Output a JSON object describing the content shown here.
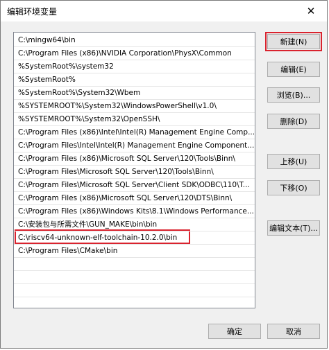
{
  "window": {
    "title": "编辑环境变量",
    "close_glyph": "✕"
  },
  "paths": [
    "C:\\mingw64\\bin",
    "C:\\Program Files (x86)\\NVIDIA Corporation\\PhysX\\Common",
    "%SystemRoot%\\system32",
    "%SystemRoot%",
    "%SystemRoot%\\System32\\Wbem",
    "%SYSTEMROOT%\\System32\\WindowsPowerShell\\v1.0\\",
    "%SYSTEMROOT%\\System32\\OpenSSH\\",
    "C:\\Program Files (x86)\\Intel\\Intel(R) Management Engine Comp...",
    "C:\\Program Files\\Intel\\Intel(R) Management Engine Component...",
    "C:\\Program Files (x86)\\Microsoft SQL Server\\120\\Tools\\Binn\\",
    "C:\\Program Files\\Microsoft SQL Server\\120\\Tools\\Binn\\",
    "C:\\Program Files\\Microsoft SQL Server\\Client SDK\\ODBC\\110\\T...",
    "C:\\Program Files (x86)\\Microsoft SQL Server\\120\\DTS\\Binn\\",
    "C:\\Program Files (x86)\\Windows Kits\\8.1\\Windows Performance...",
    "C:\\安装包与所需文件\\GUN_MAKE\\bin\\bin",
    "C:\\riscv64-unknown-elf-toolchain-10.2.0\\bin",
    "C:\\Program Files\\CMake\\bin"
  ],
  "buttons": {
    "new": "新建(N)",
    "edit": "编辑(E)",
    "browse": "浏览(B)...",
    "delete": "删除(D)",
    "move_up": "上移(U)",
    "move_down": "下移(O)",
    "edit_text": "编辑文本(T)...",
    "ok": "确定",
    "cancel": "取消"
  },
  "colors": {
    "highlight_border": "#d9232e"
  }
}
